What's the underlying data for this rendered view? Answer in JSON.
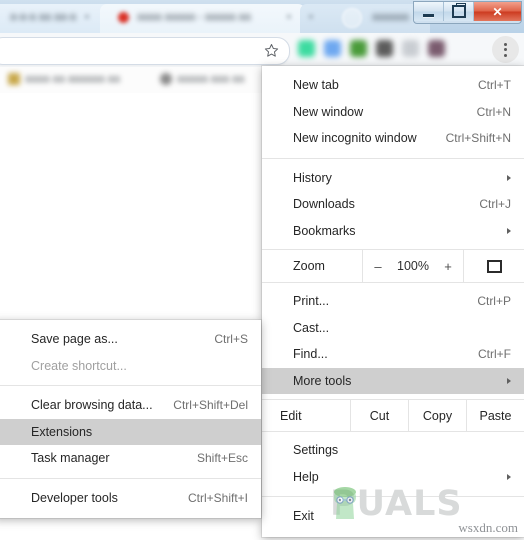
{
  "window": {
    "controls": [
      {
        "name": "minimize",
        "glyph": "—"
      },
      {
        "name": "maximize",
        "glyph": "❐"
      },
      {
        "name": "close",
        "glyph": "✕"
      }
    ]
  },
  "tabstrip": {
    "tabs": [
      {
        "title": "",
        "blurred": true
      },
      {
        "title": "",
        "blurred": true
      }
    ],
    "new_tab_label": ""
  },
  "toolbar": {
    "address_value": "",
    "address_placeholder": "",
    "star_icon": "star-icon",
    "menu_icon": "three-dot-menu-icon",
    "extensions": [
      {
        "name": "extension-icon-1",
        "color": "#3ddba0"
      },
      {
        "name": "extension-icon-2",
        "color": "#6ea8f0"
      },
      {
        "name": "extension-icon-3",
        "color": "#4a9b3a"
      },
      {
        "name": "extension-icon-4",
        "color": "#5c5c5c"
      },
      {
        "name": "extension-icon-5",
        "color": "#c9cdd2"
      },
      {
        "name": "extension-icon-6",
        "color": "#7a5b6e"
      }
    ]
  },
  "bookmarks": {
    "items": [
      {
        "label": "",
        "blurred": true
      },
      {
        "label": "",
        "blurred": true
      }
    ]
  },
  "main_menu": {
    "items": [
      {
        "type": "item",
        "label": "New tab",
        "accel": "Ctrl+T",
        "arrow": false,
        "highlighted": false,
        "disabled": false
      },
      {
        "type": "item",
        "label": "New window",
        "accel": "Ctrl+N",
        "arrow": false,
        "highlighted": false,
        "disabled": false
      },
      {
        "type": "item",
        "label": "New incognito window",
        "accel": "Ctrl+Shift+N",
        "arrow": false,
        "highlighted": false,
        "disabled": false
      },
      {
        "type": "separator"
      },
      {
        "type": "item",
        "label": "History",
        "accel": "",
        "arrow": true,
        "highlighted": false,
        "disabled": false
      },
      {
        "type": "item",
        "label": "Downloads",
        "accel": "Ctrl+J",
        "arrow": false,
        "highlighted": false,
        "disabled": false
      },
      {
        "type": "item",
        "label": "Bookmarks",
        "accel": "",
        "arrow": true,
        "highlighted": false,
        "disabled": false
      },
      {
        "type": "zoom",
        "label": "Zoom",
        "minus": "–",
        "value": "100%",
        "plus": "+",
        "fullscreen_icon": "fullscreen-icon"
      },
      {
        "type": "item",
        "label": "Print...",
        "accel": "Ctrl+P",
        "arrow": false,
        "highlighted": false,
        "disabled": false
      },
      {
        "type": "item",
        "label": "Cast...",
        "accel": "",
        "arrow": false,
        "highlighted": false,
        "disabled": false
      },
      {
        "type": "item",
        "label": "Find...",
        "accel": "Ctrl+F",
        "arrow": false,
        "highlighted": false,
        "disabled": false
      },
      {
        "type": "item",
        "label": "More tools",
        "accel": "",
        "arrow": true,
        "highlighted": true,
        "disabled": false
      },
      {
        "type": "edit",
        "label": "Edit",
        "cut": "Cut",
        "copy": "Copy",
        "paste": "Paste"
      },
      {
        "type": "item",
        "label": "Settings",
        "accel": "",
        "arrow": false,
        "highlighted": false,
        "disabled": false
      },
      {
        "type": "item",
        "label": "Help",
        "accel": "",
        "arrow": true,
        "highlighted": false,
        "disabled": false
      },
      {
        "type": "separator"
      },
      {
        "type": "item",
        "label": "Exit",
        "accel": "",
        "arrow": false,
        "highlighted": false,
        "disabled": false
      }
    ]
  },
  "sub_menu": {
    "items": [
      {
        "type": "item",
        "label": "Save page as...",
        "accel": "Ctrl+S",
        "arrow": false,
        "highlighted": false,
        "disabled": false
      },
      {
        "type": "item",
        "label": "Create shortcut...",
        "accel": "",
        "arrow": false,
        "highlighted": false,
        "disabled": true
      },
      {
        "type": "separator"
      },
      {
        "type": "item",
        "label": "Clear browsing data...",
        "accel": "Ctrl+Shift+Del",
        "arrow": false,
        "highlighted": false,
        "disabled": false
      },
      {
        "type": "item",
        "label": "Extensions",
        "accel": "",
        "arrow": false,
        "highlighted": true,
        "disabled": false
      },
      {
        "type": "item",
        "label": "Task manager",
        "accel": "Shift+Esc",
        "arrow": false,
        "highlighted": false,
        "disabled": false
      },
      {
        "type": "separator"
      },
      {
        "type": "item",
        "label": "Developer tools",
        "accel": "Ctrl+Shift+I",
        "arrow": false,
        "highlighted": false,
        "disabled": false
      }
    ]
  },
  "watermark": {
    "brand": "PUALS",
    "mascot": "appuals-mascot-icon",
    "source": "wsxdn.com"
  },
  "colors": {
    "highlight": "#cfcfcf",
    "menu_bg": "#ffffff",
    "text": "#262626",
    "accel_text": "#6f6f6f",
    "disabled_text": "#a0a0a0",
    "separator": "#e4e4e4",
    "tabstrip": "#c2d7ea",
    "close_button": "#cd3c21"
  }
}
